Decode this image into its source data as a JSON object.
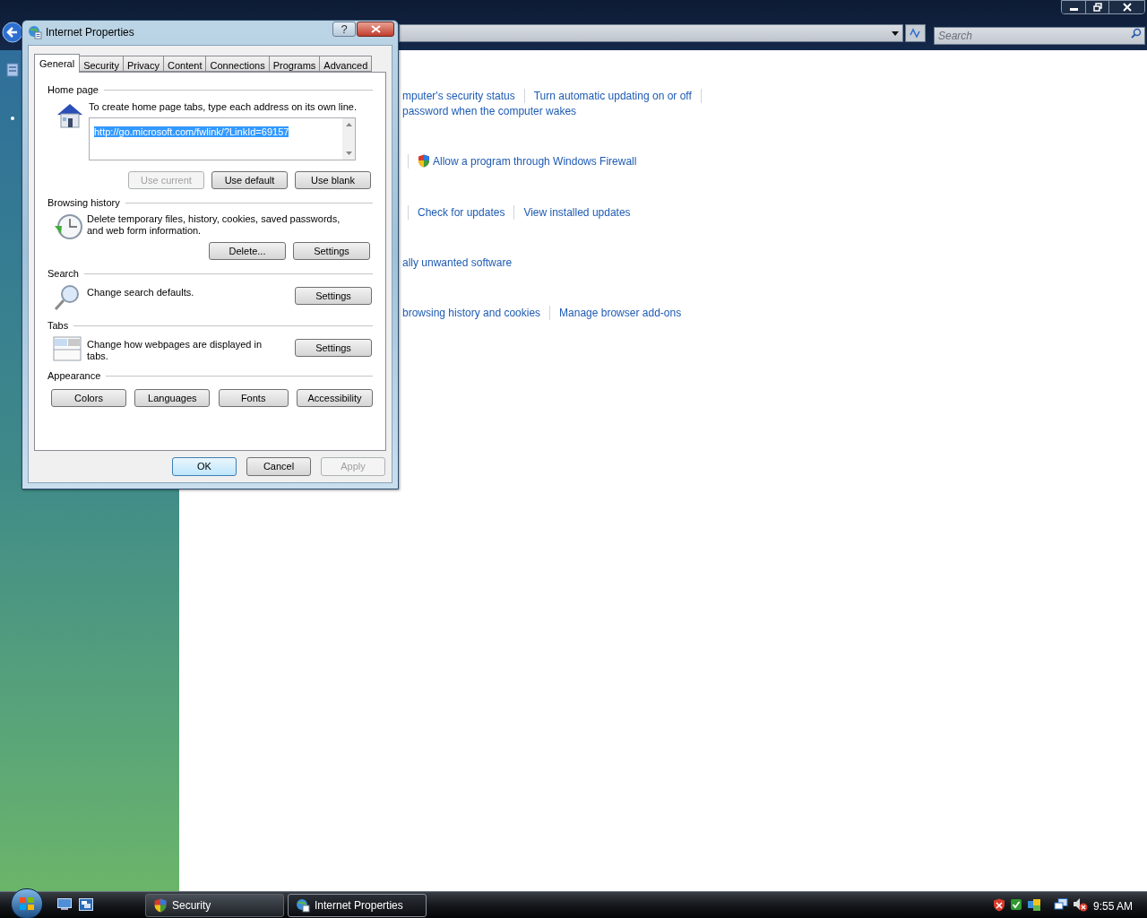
{
  "explorer": {
    "search": {
      "placeholder": "Search"
    },
    "link_rows": [
      {
        "items": [
          {
            "kind": "link",
            "text": "mputer's security status"
          },
          {
            "kind": "separator"
          },
          {
            "kind": "link",
            "text": "Turn automatic updating on or off"
          },
          {
            "kind": "separator"
          }
        ]
      },
      {
        "items": [
          {
            "kind": "link",
            "text": "password when the computer wakes"
          }
        ]
      },
      {
        "items": [
          {
            "kind": "separator"
          },
          {
            "kind": "shield-link",
            "text": "Allow a program through Windows Firewall"
          }
        ]
      },
      {
        "items": [
          {
            "kind": "separator"
          },
          {
            "kind": "link",
            "text": "Check for updates"
          },
          {
            "kind": "separator"
          },
          {
            "kind": "link",
            "text": "View installed updates"
          }
        ]
      },
      {
        "items": [
          {
            "kind": "link",
            "text": "ally unwanted software"
          }
        ]
      },
      {
        "items": [
          {
            "kind": "link",
            "text": "browsing history and cookies"
          },
          {
            "kind": "separator"
          },
          {
            "kind": "link",
            "text": "Manage browser add-ons"
          }
        ]
      }
    ]
  },
  "dialog": {
    "title": "Internet Properties",
    "help_button": "?",
    "tabs": [
      {
        "label": "General",
        "selected": true
      },
      {
        "label": "Security",
        "selected": false
      },
      {
        "label": "Privacy",
        "selected": false
      },
      {
        "label": "Content",
        "selected": false
      },
      {
        "label": "Connections",
        "selected": false
      },
      {
        "label": "Programs",
        "selected": false
      },
      {
        "label": "Advanced",
        "selected": false
      }
    ],
    "sections": [
      {
        "kind": "home",
        "heading": "Home page",
        "description": "To create home page tabs, type each address on its own line.",
        "url": "http://go.microsoft.com/fwlink/?LinkId=69157",
        "buttons": [
          {
            "label": "Use current",
            "disabled": true
          },
          {
            "label": "Use default",
            "disabled": false
          },
          {
            "label": "Use blank",
            "disabled": false
          }
        ]
      },
      {
        "kind": "history",
        "heading": "Browsing history",
        "description": "Delete temporary files, history, cookies, saved passwords, and web form information.",
        "buttons": [
          {
            "label": "Delete...",
            "disabled": false
          },
          {
            "label": "Settings",
            "disabled": false
          }
        ]
      },
      {
        "kind": "search",
        "heading": "Search",
        "description": "Change search defaults.",
        "buttons": [
          {
            "label": "Settings",
            "disabled": false
          }
        ]
      },
      {
        "kind": "tabs",
        "heading": "Tabs",
        "description": "Change how webpages are displayed in tabs.",
        "buttons": [
          {
            "label": "Settings",
            "disabled": false
          }
        ]
      },
      {
        "kind": "appearance",
        "heading": "Appearance",
        "buttons": [
          {
            "label": "Colors",
            "disabled": false
          },
          {
            "label": "Languages",
            "disabled": false
          },
          {
            "label": "Fonts",
            "disabled": false
          },
          {
            "label": "Accessibility",
            "disabled": false
          }
        ]
      }
    ],
    "footer_buttons": [
      {
        "label": "OK",
        "disabled": false,
        "default": true
      },
      {
        "label": "Cancel",
        "disabled": false,
        "default": false
      },
      {
        "label": "Apply",
        "disabled": true,
        "default": false
      }
    ]
  },
  "taskbar": {
    "tasks": [
      {
        "kind": "shield",
        "label": "Security",
        "selected": false
      },
      {
        "kind": "globe",
        "label": "Internet Properties",
        "selected": true
      }
    ],
    "clock": "9:55 AM"
  }
}
